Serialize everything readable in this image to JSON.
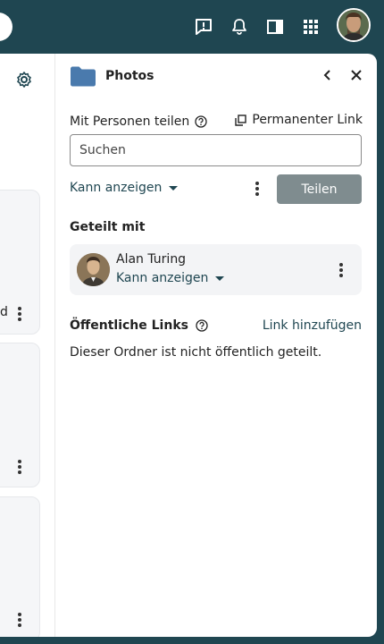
{
  "topbar": {
    "icons": [
      "feedback-icon",
      "bell-icon",
      "sidebar-toggle-icon",
      "apps-grid-icon"
    ],
    "avatar_alt": "user-avatar"
  },
  "main": {
    "partial_text": "d",
    "gear_icon": "gear-icon"
  },
  "sidebar": {
    "title": "Photos",
    "share_label": "Mit Personen teilen",
    "permalink_label": "Permanenter Link",
    "search_placeholder": "Suchen",
    "permission_label": "Kann anzeigen",
    "share_button": "Teilen",
    "shared_with_title": "Geteilt mit",
    "shared_users": [
      {
        "name": "Alan Turing",
        "permission": "Kann anzeigen"
      }
    ],
    "public_links_title": "Öffentliche Links",
    "add_link_label": "Link hinzufügen",
    "not_shared_text": "Dieser Ordner ist nicht öffentlich geteilt."
  },
  "colors": {
    "topbar_bg": "#1f4651",
    "accent": "#1f4651",
    "button_disabled": "#7f8c8f",
    "folder": "#4a7aad"
  }
}
